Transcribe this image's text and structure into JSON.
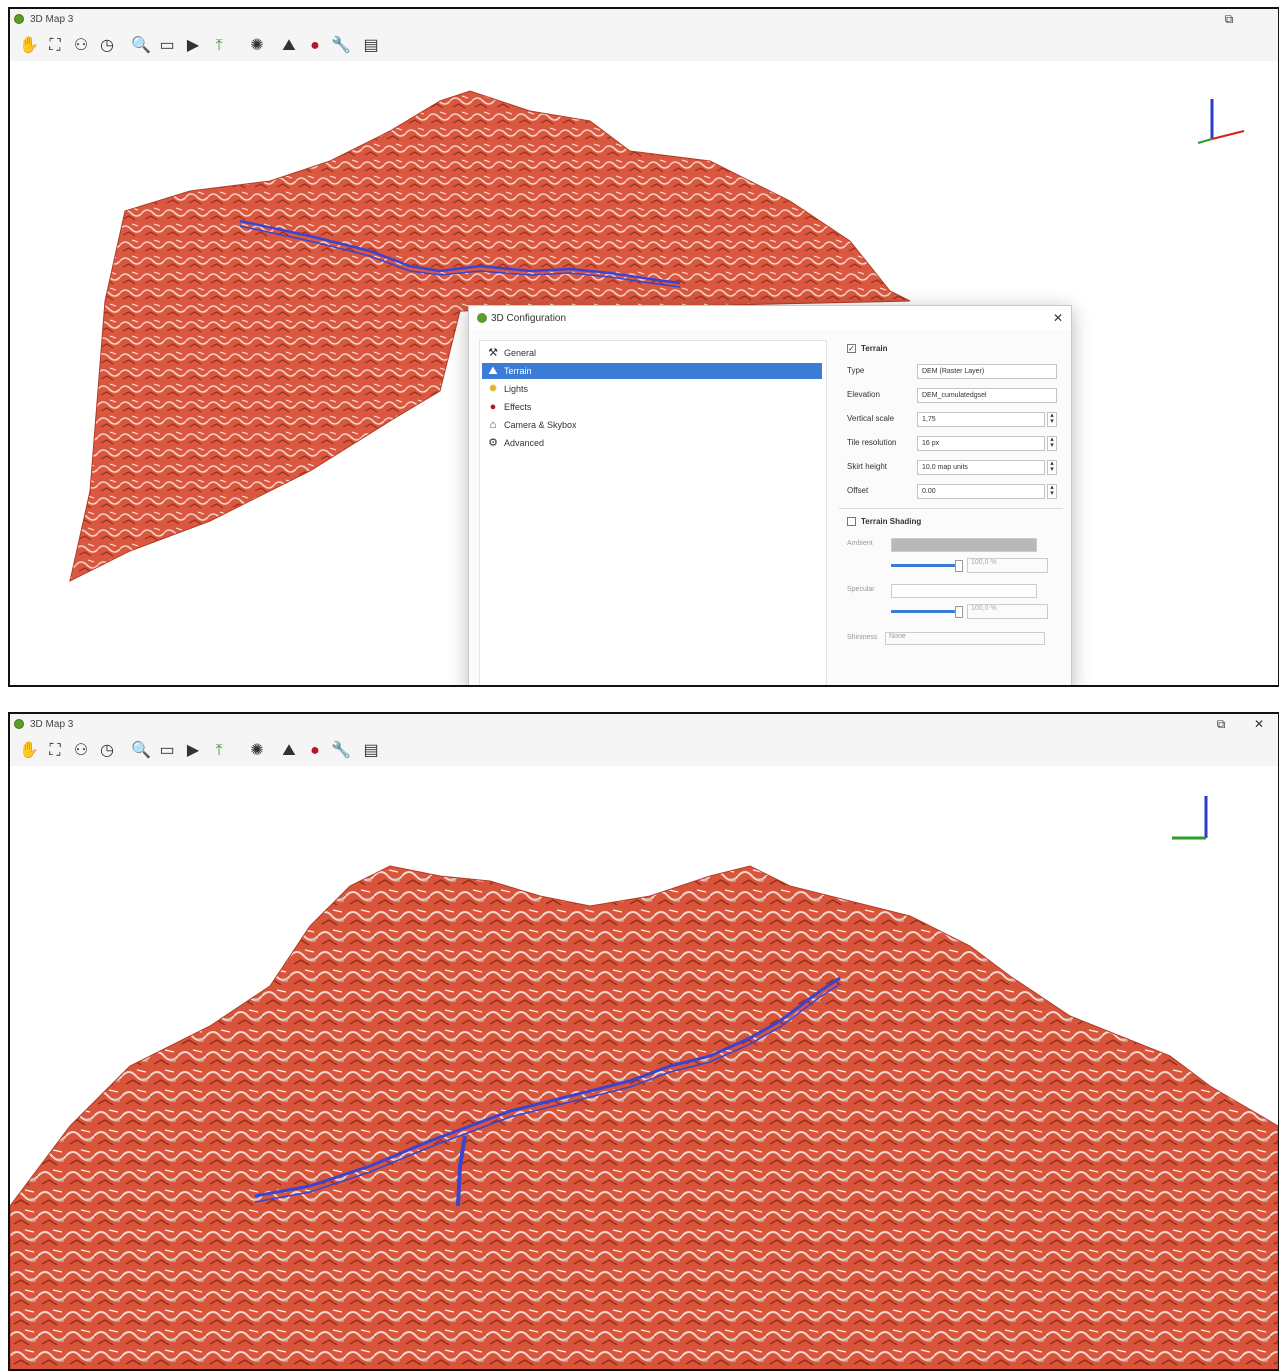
{
  "window_top": {
    "title": "3D Map 3",
    "toolbar_icons": [
      "pan-hand-icon",
      "zoom-full-icon",
      "identify-icon",
      "animations-clock-icon",
      "zoom-icon",
      "measure-icon",
      "play-icon",
      "export-icon",
      "camera-icon",
      "terrain-icon",
      "effects-icon",
      "tools-icon",
      "table-icon"
    ],
    "colors": {
      "terrain": "#d9583f",
      "river": "#3a44d0",
      "selection": "#3b7cd6"
    }
  },
  "dialog": {
    "title": "3D Configuration",
    "close": "✕",
    "nav_items": [
      {
        "label": "General",
        "icon": "wrench-icon"
      },
      {
        "label": "Terrain",
        "icon": "terrain-icon"
      },
      {
        "label": "Lights",
        "icon": "bulb-icon"
      },
      {
        "label": "Effects",
        "icon": "effects-icon"
      },
      {
        "label": "Camera & Skybox",
        "icon": "camera-icon"
      },
      {
        "label": "Advanced",
        "icon": "gear-icon"
      }
    ],
    "selected_nav": "Terrain",
    "terrain": {
      "checkbox": "Terrain",
      "checked": true,
      "rows": [
        {
          "label": "Type",
          "value": "DEM (Raster Layer)"
        },
        {
          "label": "Elevation",
          "value": "DEM_cumulatedgsel"
        },
        {
          "label": "Vertical scale",
          "value": "1,75"
        },
        {
          "label": "Tile resolution",
          "value": "16 px"
        },
        {
          "label": "Skirt height",
          "value": "10.0 map units"
        },
        {
          "label": "Offset",
          "value": "0.00"
        }
      ]
    },
    "shading": {
      "checkbox": "Terrain Shading",
      "ambient_label": "Ambient",
      "ambient_value": "100,0 %",
      "specular_label": "Specular",
      "specular_value": "100,0 %",
      "shininess_label": "Shininess",
      "shininess_value": "None"
    }
  },
  "window_bottom": {
    "title": "3D Map 3",
    "restore": "⧉",
    "close": "✕"
  }
}
